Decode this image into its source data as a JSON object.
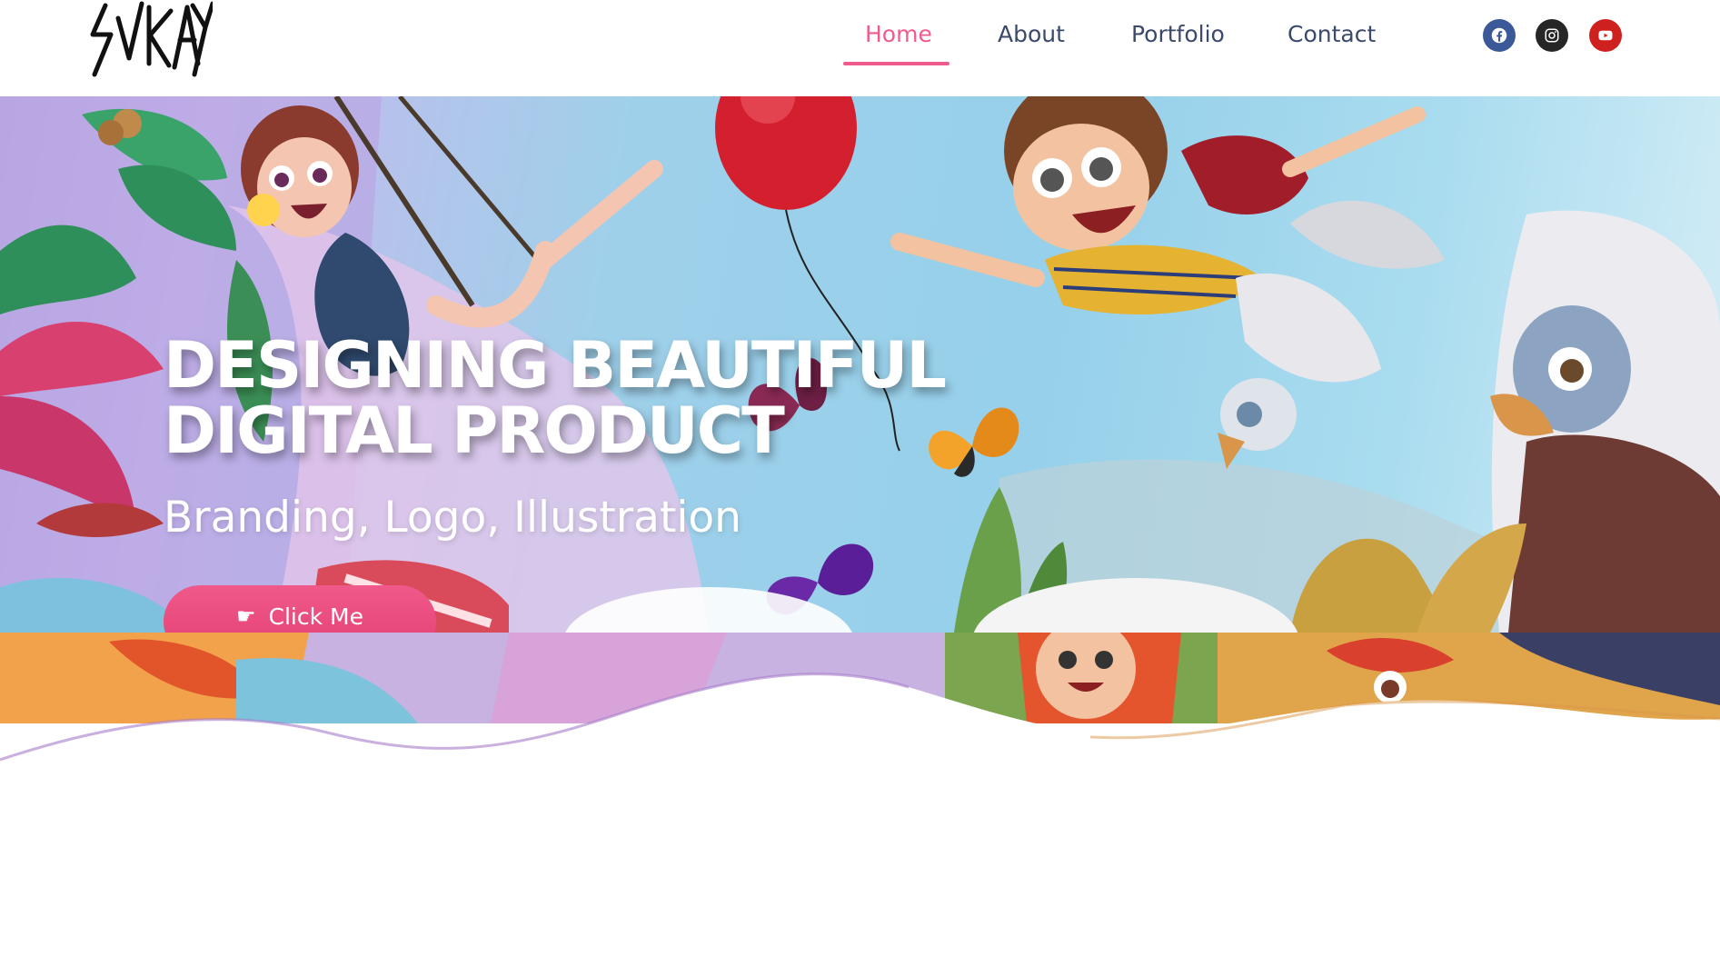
{
  "brand": {
    "logo_text": "SVKAY"
  },
  "nav": {
    "items": [
      {
        "label": "Home",
        "active": true
      },
      {
        "label": "About",
        "active": false
      },
      {
        "label": "Portfolio",
        "active": false
      },
      {
        "label": "Contact",
        "active": false
      }
    ]
  },
  "social": [
    {
      "name": "facebook-icon",
      "color": "#3b5998"
    },
    {
      "name": "instagram-icon",
      "color": "#262626"
    },
    {
      "name": "youtube-icon",
      "color": "#cd201f"
    }
  ],
  "hero": {
    "title_line1": "DESIGNING BEAUTIFUL",
    "title_line2": "DIGITAL PRODUCT",
    "subtitle": "Branding, Logo, Illustration",
    "cta_label": "Click Me"
  },
  "colors": {
    "accent": "#ef5b8f",
    "nav_text": "#3b4a6b"
  }
}
